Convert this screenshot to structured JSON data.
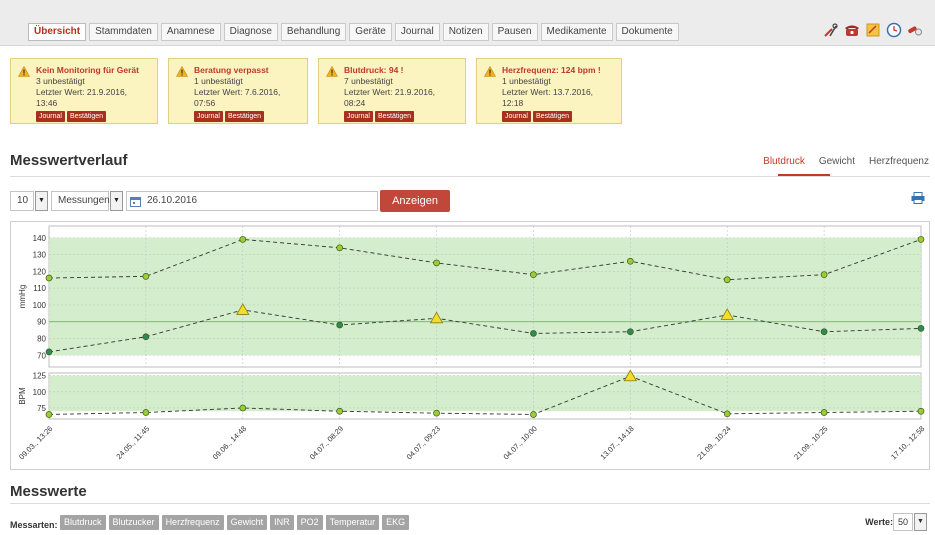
{
  "tabs": [
    "Übersicht",
    "Stammdaten",
    "Anamnese",
    "Diagnose",
    "Behandlung",
    "Geräte",
    "Journal",
    "Notizen",
    "Pausen",
    "Medikamente",
    "Dokumente"
  ],
  "toolbar_icons": [
    "tools-icon",
    "phone-icon",
    "note-icon",
    "clock-icon",
    "pills-icon"
  ],
  "alerts": [
    {
      "title": "Kein Monitoring für Gerät",
      "count": "3 unbestätigt",
      "last": "Letzter Wert: 21.9.2016, 13:46",
      "journal": "Journal",
      "confirm": "Bestätigen"
    },
    {
      "title": "Beratung verpasst",
      "count": "1 unbestätigt",
      "last": "Letzter Wert: 7.6.2016, 07:56",
      "journal": "Journal",
      "confirm": "Bestätigen"
    },
    {
      "title": "Blutdruck: 94 !",
      "count": "7 unbestätigt",
      "last": "Letzter Wert: 21.9.2016, 08:24",
      "journal": "Journal",
      "confirm": "Bestätigen"
    },
    {
      "title": "Herzfrequenz: 124 bpm !",
      "count": "1 unbestätigt",
      "last": "Letzter Wert: 13.7.2016, 12:18",
      "journal": "Journal",
      "confirm": "Bestätigen"
    }
  ],
  "measure_section": {
    "title": "Messwertverlauf",
    "tabs": [
      "Blutdruck",
      "Gewicht",
      "Herzfrequenz"
    ],
    "active_tab": "Blutdruck"
  },
  "controls": {
    "count": "10",
    "unit": "Messungen",
    "date": "26.10.2016",
    "show_button": "Anzeigen"
  },
  "chart_data": [
    {
      "type": "line",
      "ylabel": "mmHg",
      "ylim": [
        63,
        147
      ],
      "yticks": [
        70,
        80,
        90,
        100,
        110,
        120,
        130,
        140
      ],
      "x": [
        "09.03., 13:26",
        "24.05., 11:45",
        "09.06., 14:48",
        "04.07., 08:29",
        "04.07., 09:23",
        "04.07., 10:00",
        "13.07., 14:18",
        "21.09., 10:24",
        "21.09., 10:25",
        "17.10., 12:58"
      ],
      "series": [
        {
          "values": [
            116,
            117,
            139,
            134,
            125,
            118,
            126,
            115,
            118,
            139
          ],
          "color": "#9acd32"
        },
        {
          "values": [
            72,
            81,
            97,
            88,
            92,
            83,
            84,
            94,
            84,
            86
          ],
          "color": "#2e8b57",
          "alerts": [
            2,
            4,
            7
          ]
        }
      ],
      "band": [
        70,
        140
      ],
      "reference": 90,
      "grid": true
    },
    {
      "type": "line",
      "ylabel": "BPM",
      "ylim": [
        58,
        129
      ],
      "yticks": [
        75,
        100,
        125
      ],
      "x": [
        "09.03., 13:26",
        "24.05., 11:45",
        "09.06., 14:48",
        "04.07., 08:29",
        "04.07., 09:23",
        "04.07., 10:00",
        "13.07., 14:18",
        "21.09., 10:24",
        "21.09., 10:25",
        "17.10., 12:58"
      ],
      "series": [
        {
          "values": [
            65,
            68,
            75,
            70,
            67,
            65,
            124,
            66,
            68,
            70
          ],
          "alerts": [
            6
          ]
        }
      ],
      "band": [
        70,
        125
      ],
      "grid": true
    }
  ],
  "values_section": {
    "title": "Messwerte",
    "types_label": "Messarten:",
    "types": [
      "Blutdruck",
      "Blutzucker",
      "Herzfrequenz",
      "Gewicht",
      "INR",
      "PO2",
      "Temperatur",
      "EKG"
    ],
    "count_label": "Werte:",
    "count": "50"
  }
}
